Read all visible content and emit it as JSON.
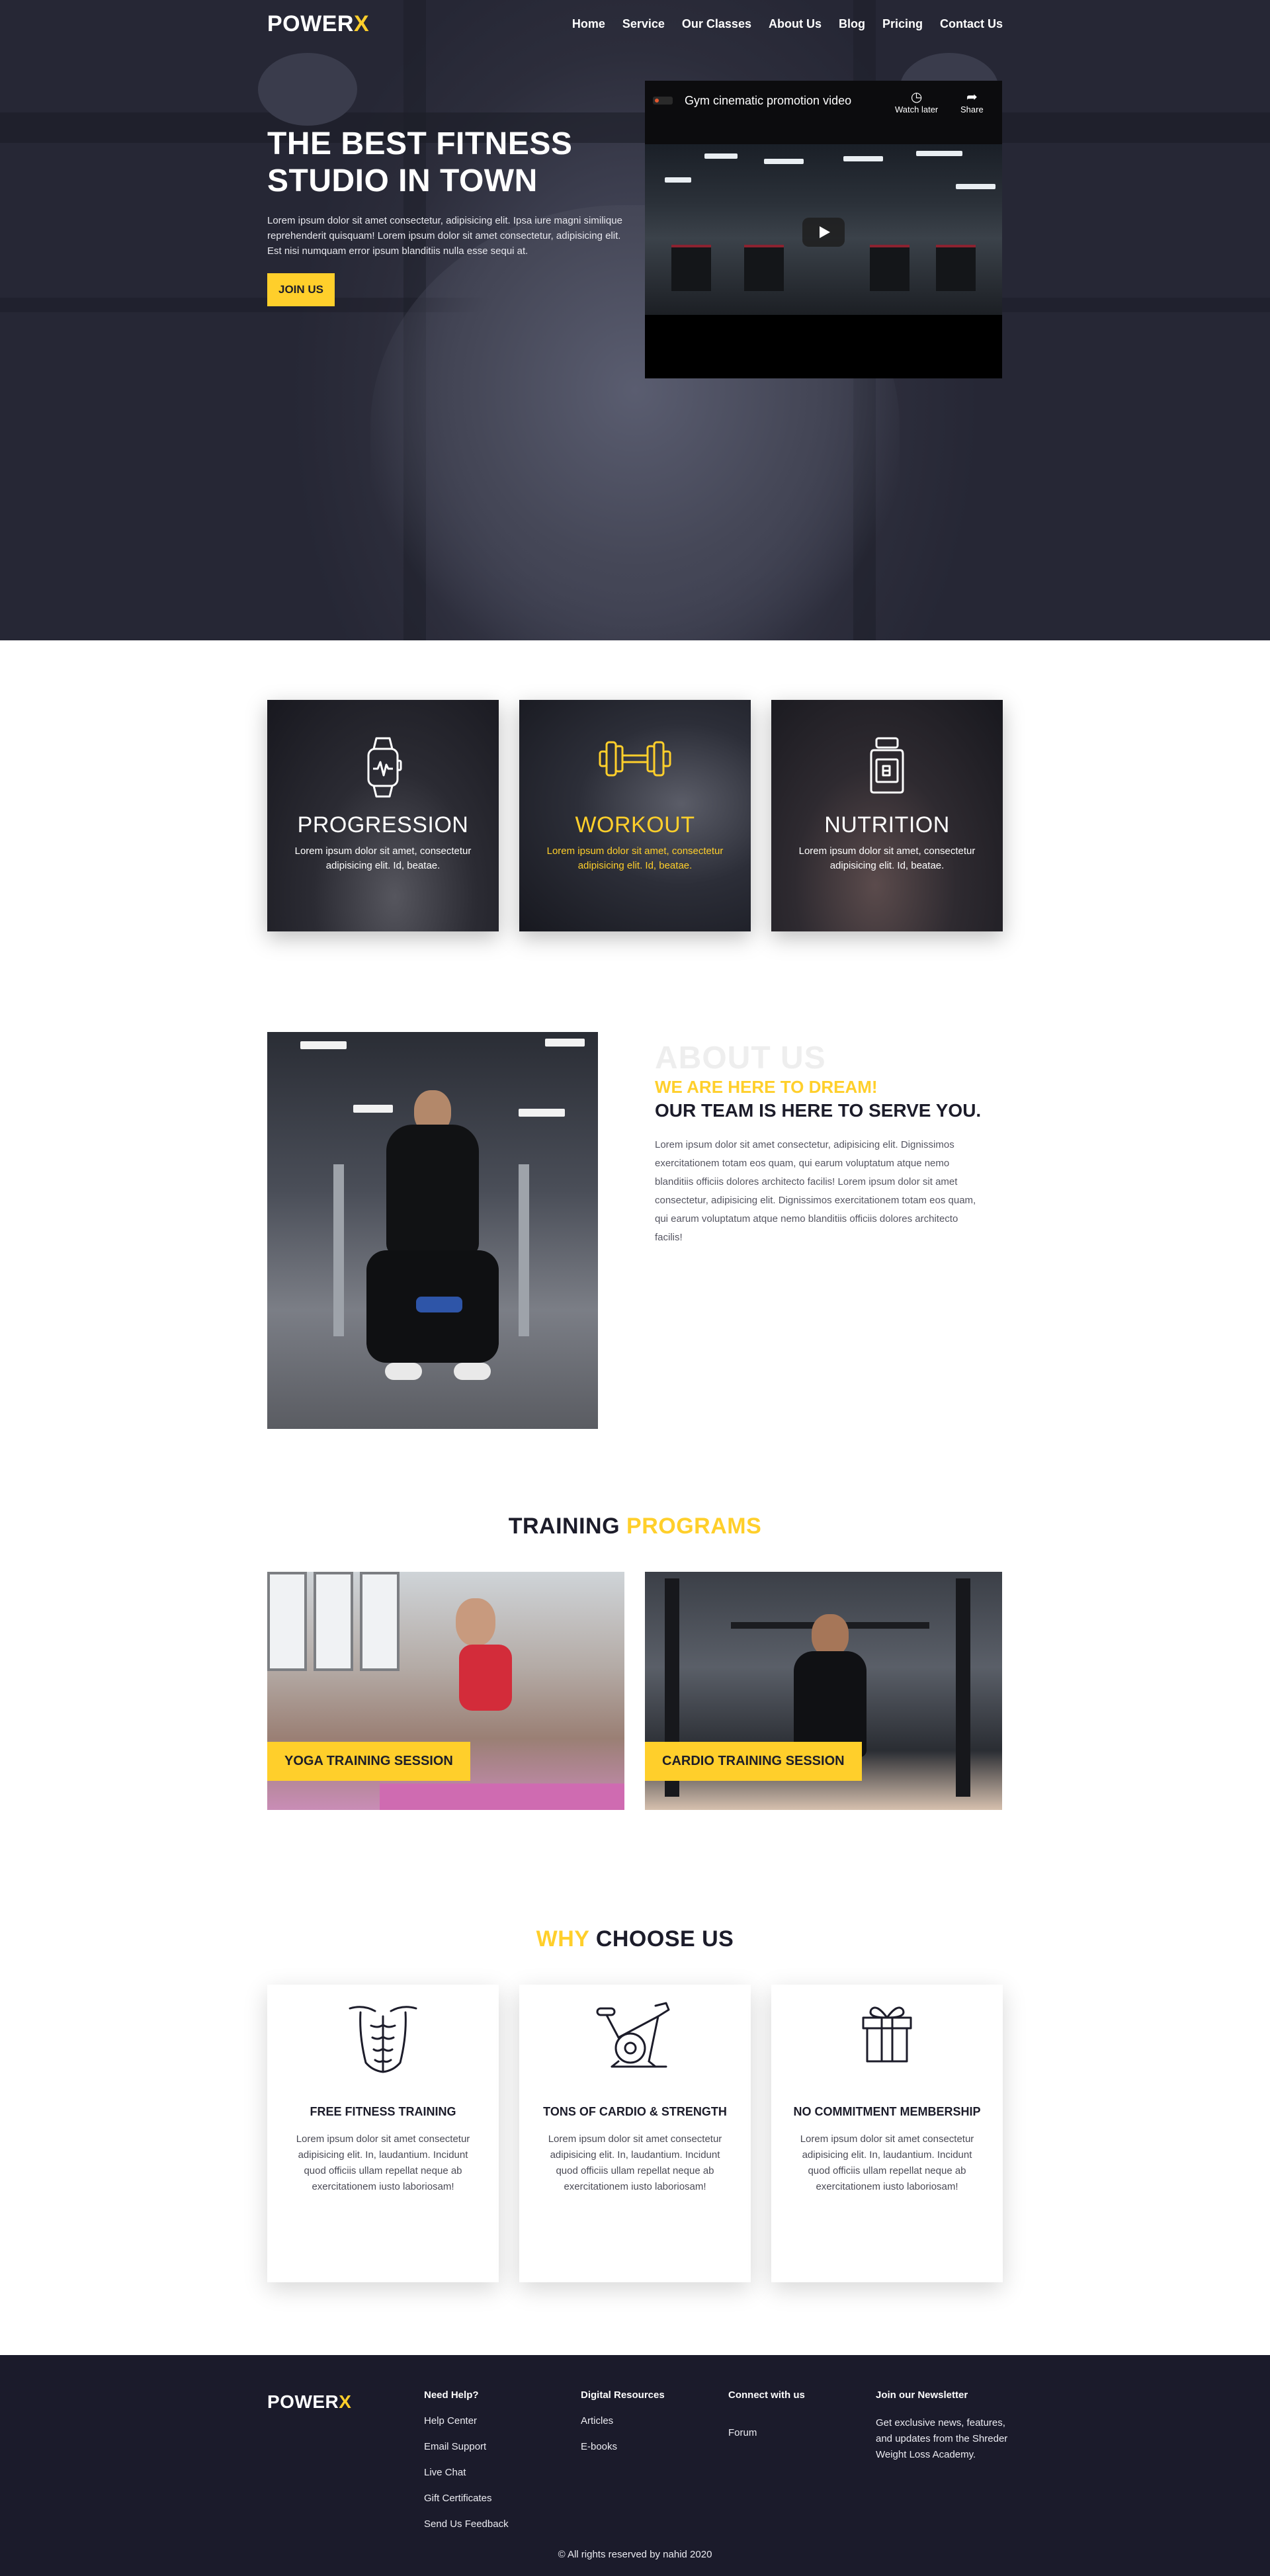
{
  "brand": {
    "name": "POWER",
    "accent_letter": "X",
    "accent_color": "#ffcf2b",
    "dark_color": "#1b1b2b"
  },
  "nav": {
    "items": [
      "Home",
      "Service",
      "Our Classes",
      "About Us",
      "Blog",
      "Pricing",
      "Contact Us"
    ]
  },
  "hero": {
    "title_line1": "THE BEST FITNESS",
    "title_line2": "STUDIO IN TOWN",
    "description": "Lorem ipsum dolor sit amet consectetur, adipisicing elit. Ipsa iure magni similique reprehenderit quisquam! Lorem ipsum dolor sit amet consectetur, adipisicing elit. Est nisi numquam error ipsum blanditiis nulla esse sequi at.",
    "cta_label": "JOIN US",
    "video": {
      "title": "Gym cinematic promotion video",
      "watch_later": "Watch later",
      "share": "Share"
    }
  },
  "features": [
    {
      "title": "PROGRESSION",
      "description": "Lorem ipsum dolor sit amet, consectetur adipisicing elit. Id, beatae.",
      "icon": "smartwatch-icon"
    },
    {
      "title": "WORKOUT",
      "description": "Lorem ipsum dolor sit amet, consectetur adipisicing elit. Id, beatae.",
      "icon": "dumbbell-icon"
    },
    {
      "title": "NUTRITION",
      "description": "Lorem ipsum dolor sit amet, consectetur adipisicing elit. Id, beatae.",
      "icon": "supplement-jar-icon"
    }
  ],
  "about": {
    "ghost_title": "ABOUT US",
    "kicker": "WE ARE HERE TO DREAM!",
    "heading": "OUR TEAM IS HERE TO SERVE YOU.",
    "body": "Lorem ipsum dolor sit amet consectetur, adipisicing elit. Dignissimos exercitationem totam eos quam, qui earum voluptatum atque nemo blanditiis officiis dolores architecto facilis! Lorem ipsum dolor sit amet consectetur, adipisicing elit. Dignissimos exercitationem totam eos quam, qui earum voluptatum atque nemo blanditiis officiis dolores architecto facilis!"
  },
  "training": {
    "title_dark": "TRAINING",
    "title_yellow": "PROGRAMS",
    "programs": [
      {
        "label": "YOGA TRAINING SESSION"
      },
      {
        "label": "CARDIO TRAINING SESSION"
      }
    ]
  },
  "why": {
    "title_yellow": "WHY",
    "title_dark": "CHOOSE US",
    "items": [
      {
        "title": "FREE FITNESS TRAINING",
        "description": "Lorem ipsum dolor sit amet consectetur adipisicing elit. In, laudantium. Incidunt quod officiis ullam repellat neque ab exercitationem iusto laboriosam!",
        "icon": "abs-torso-icon"
      },
      {
        "title": "TONS OF CARDIO & STRENGTH",
        "description": "Lorem ipsum dolor sit amet consectetur adipisicing elit. In, laudantium. Incidunt quod officiis ullam repellat neque ab exercitationem iusto laboriosam!",
        "icon": "exercise-bike-icon"
      },
      {
        "title": "NO COMMITMENT MEMBERSHIP",
        "description": "Lorem ipsum dolor sit amet consectetur adipisicing elit. In, laudantium. Incidunt quod officiis ullam repellat neque ab exercitationem iusto laboriosam!",
        "icon": "gift-box-icon"
      }
    ]
  },
  "footer": {
    "help": {
      "heading": "Need Help?",
      "links": [
        "Help Center",
        "Email Support",
        "Live Chat",
        "Gift Certificates",
        "Send Us Feedback"
      ]
    },
    "resources": {
      "heading": "Digital Resources",
      "links": [
        "Articles",
        "E-books"
      ]
    },
    "connect": {
      "heading": "Connect with us",
      "links": [
        "Forum"
      ]
    },
    "newsletter": {
      "heading": "Join our Newsletter",
      "text": "Get exclusive news, features, and updates from the Shreder Weight Loss Academy."
    },
    "copyright": "© All rights reserved by nahid 2020"
  }
}
